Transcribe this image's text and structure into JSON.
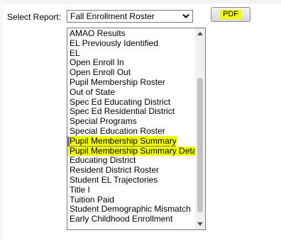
{
  "form": {
    "label": "Select Report:",
    "selected_value": "Fall Enrollment Roster",
    "pdf_label": "PDF"
  },
  "options": [
    "AMAO Results",
    "EL Previously Identified",
    "EL",
    "Open Enroll In",
    "Open Enroll Out",
    "Pupil Membership Roster",
    "Out of State",
    "Spec Ed Educating District",
    "Spec Ed Residential District",
    "Special Programs",
    "Special Education Roster",
    "Pupil Membership Summary",
    "Pupil Membership Summary Detail",
    "Educating District",
    "Resident District Roster",
    "Student EL Trajectories",
    "Title I",
    "Tuition Paid",
    "Student Demographic Mismatch",
    "Early Childhood Enrollment"
  ],
  "colors": {
    "highlight": "#f2ff00",
    "selected_row": "#808080"
  },
  "icons": {
    "select_chevron": "chevron-down-icon",
    "scroll_up": "scroll-up-arrow-icon",
    "scroll_down": "scroll-down-arrow-icon"
  }
}
